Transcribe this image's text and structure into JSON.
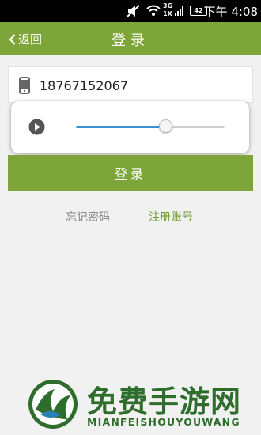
{
  "status_bar": {
    "network_label": "3G",
    "network_sub": "1X",
    "battery_level": "42",
    "time": "下午 4:08"
  },
  "header": {
    "back_label": "返回",
    "title": "登录"
  },
  "login_form": {
    "phone_value": "18767152067",
    "login_button": "登录",
    "forgot_password": "忘记密码",
    "register": "注册账号"
  },
  "audio_popup": {
    "progress_fraction": 0.6
  },
  "watermark": {
    "title": "免费手游网",
    "subtitle": "MIANFEISHOUYOUWANG"
  },
  "colors": {
    "brand_green": "#7ea53a",
    "slider_blue": "#3a93d8",
    "watermark_green": "#2f6d2c"
  }
}
